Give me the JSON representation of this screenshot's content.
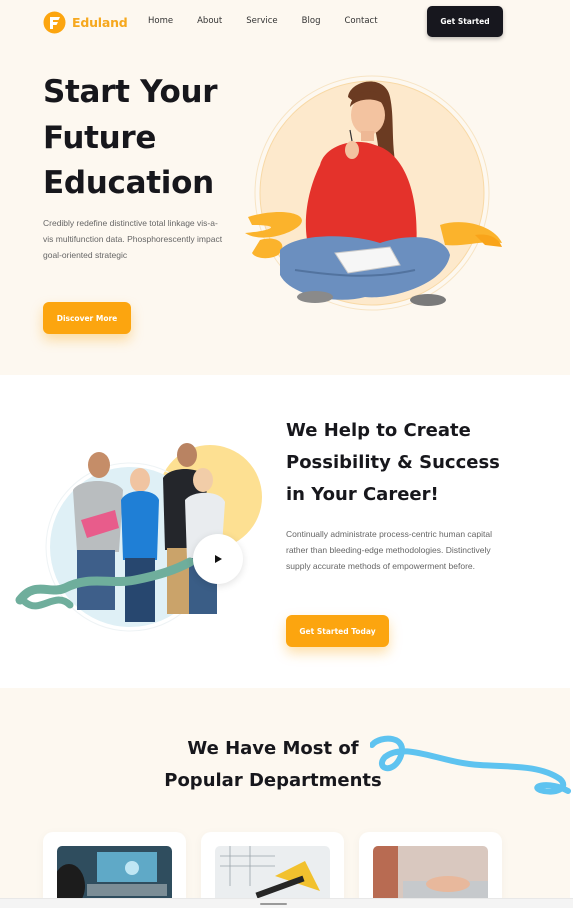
{
  "brand": {
    "name": "Eduland",
    "accent": "#fca50f",
    "dark": "#17171e"
  },
  "nav": {
    "items": [
      "Home",
      "About",
      "Service",
      "Blog",
      "Contact"
    ],
    "cta": "Get Started"
  },
  "hero": {
    "title_lines": [
      "Start Your",
      "Future",
      "Education"
    ],
    "description": "Credibly redefine distinctive total linkage vis-a-vis multifunction data. Phosphorescently impact goal-oriented strategic",
    "button": "Discover More"
  },
  "about": {
    "title_lines": [
      "We Help to Create",
      "Possibility & Success",
      "in Your Career!"
    ],
    "description": "Continually administrate process-centric human capital rather than bleeding-edge methodologies. Distinctively supply accurate methods of empowerment before.",
    "button": "Get Started Today",
    "video_icon": "play-icon"
  },
  "departments": {
    "title_lines": [
      "We Have Most of",
      "Popular Departments"
    ],
    "cards": [
      {
        "image": "laptop-tech-image"
      },
      {
        "image": "architecture-drawing-image"
      },
      {
        "image": "typing-laptop-image"
      }
    ]
  }
}
